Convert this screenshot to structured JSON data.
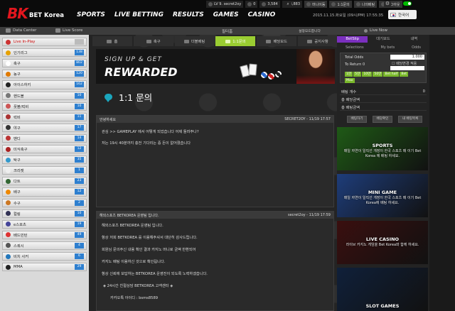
{
  "header": {
    "logo_mark": "BK",
    "logo_text": "BET Korea",
    "nav": [
      "SPORTS",
      "LIVE BETTING",
      "RESULTS",
      "GAMES",
      "CASINO"
    ],
    "level": "LV 9. secret2oy",
    "points1": "0",
    "points2": "3,584",
    "points3": "3,883",
    "menu1": "머니이동",
    "menu2": "1:1문의",
    "menu3": "나의배팅",
    "menu4": "로그아웃",
    "datetime": "2015.11.15.화요일 (09시/PM) 17:55:35",
    "language": "한국어"
  },
  "subbar": {
    "data_center": "Data Center",
    "live_score": "Live Score",
    "center_label": "필터홈",
    "settings": "설정모드합니다",
    "live_now": "Live Now"
  },
  "sidebar": {
    "items": [
      {
        "label": "Live In-Play",
        "count": ""
      },
      {
        "label": "인기리그",
        "count": "138"
      },
      {
        "label": "축구",
        "count": "802"
      },
      {
        "label": "농구",
        "count": "120"
      },
      {
        "label": "아이스하키",
        "count": "162"
      },
      {
        "label": "핸드볼",
        "count": "10"
      },
      {
        "label": "풋볼/럭비",
        "count": "10"
      },
      {
        "label": "럭비",
        "count": "11"
      },
      {
        "label": "야구",
        "count": "17"
      },
      {
        "label": "밴디",
        "count": "14"
      },
      {
        "label": "미식축구",
        "count": "12"
      },
      {
        "label": "탁구",
        "count": "35"
      },
      {
        "label": "크리켓",
        "count": "1"
      },
      {
        "label": "다트",
        "count": "23"
      },
      {
        "label": "배구",
        "count": "12"
      },
      {
        "label": "수구",
        "count": "2"
      },
      {
        "label": "컬링",
        "count": "10"
      },
      {
        "label": "e스포츠",
        "count": "19"
      },
      {
        "label": "배드민턴",
        "count": "49"
      },
      {
        "label": "스쿼시",
        "count": "4"
      },
      {
        "label": "비치 사커",
        "count": "6"
      },
      {
        "label": "MMA",
        "count": "29"
      }
    ]
  },
  "tabs": [
    {
      "label": "홈"
    },
    {
      "label": "축구"
    },
    {
      "label": "더블베팅"
    },
    {
      "label": "1:1문의"
    },
    {
      "label": "배당모드"
    },
    {
      "label": "공지사항"
    }
  ],
  "banner": {
    "line1": "SIGN UP & GET",
    "line2": "REWARDED"
  },
  "page_title": "1:1 문의",
  "inquiry": {
    "header_left": "안녕하세요",
    "header_right": "SECRET2OY - 11/19 17:57",
    "line1": "관심 >> GAMEPLAY 에서 어떻게 되었습니다 어제 돌려주나?",
    "line2": "저는 19시 40분까지 충전 기다리는 중 돈이 없어졌습니다"
  },
  "reply": {
    "header_left": "해외스포츠 BETKOREA 운영팀 입니다.",
    "header_right": "secret2oy - 11/19 17:59",
    "lines": [
      "해외스포츠 BETKOREA 운영팀 입니다.",
      "항상 저희 BETKOREA 를 이용해주셔서 대단히 감사드립니다.",
      "회원님 문의주신 내용 확인 결과 카지노 머니로 금액 반환되어",
      "카지노 배팅 이용하신 것으로 확인됩니다.",
      "항상 신뢰에 보답하는 BETKOREA 운영진이 되도록 노력하겠습니다.",
      "◈ 24시간 친절상담 BETKOREA 고객센터 ◈",
      "카카오톡 아이디 : bsms8589"
    ]
  },
  "betslip": {
    "tabs": [
      "BetSlip",
      "대기모드",
      "내역"
    ],
    "headers": [
      "Selections",
      "My bets",
      "Odds"
    ],
    "total_odds_label": "Total Odds",
    "total_odds_value": "1.000",
    "return_label": "To Return 0",
    "check_label": "배당변경 적용",
    "amounts": [
      "1만",
      "5만",
      "10만",
      "50만",
      "Bet half",
      "Bet"
    ],
    "max_label": "Max",
    "rows": [
      {
        "label": "배팅 개수",
        "value": "0"
      },
      {
        "label": "총 배당금액",
        "value": ""
      },
      {
        "label": "총 배팅금액",
        "value": ""
      },
      {
        "label": "총 예상금",
        "value": ""
      }
    ],
    "buttons": [
      "배팅하기",
      "배당확인",
      "내 배팅목록"
    ]
  },
  "promos": [
    {
      "title": "SPORTS",
      "desc": "매일 자연이 일직선 개장이 한국 스포츠 메 이기 Bet Korea 에 배팅 하세요.",
      "bg": "#1f5a16"
    },
    {
      "title": "MINI GAME",
      "desc": "매일 자연이 일직선 개장이 한국 스포츠 메 이기 Bet Korea에 배팅 하세요.",
      "bg": "#1e3d7a"
    },
    {
      "title": "LIVE CASINO",
      "desc": "라이브 카지노 게임을 Bet Korea와 함께 하세요.",
      "bg": "#3a0f0f"
    },
    {
      "title": "SLOT GAMES",
      "desc": "",
      "bg": "#10203a"
    }
  ],
  "colors": {
    "brand_red": "#e3161e",
    "active_tab": "#9acd32",
    "betslip_purple": "#7b2fbf",
    "count_blue": "#2e7fcf"
  }
}
